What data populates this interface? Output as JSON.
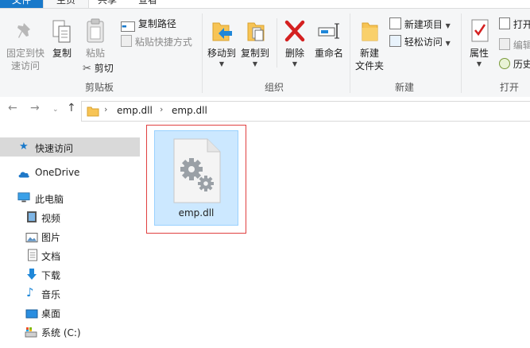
{
  "tabs": {
    "file": "文件",
    "home": "主页",
    "share": "共享",
    "view": "查看"
  },
  "ribbon": {
    "clipboard": {
      "pin_label_1": "固定到快",
      "pin_label_2": "速访问",
      "copy": "复制",
      "paste": "粘贴",
      "copy_path": "复制路径",
      "paste_shortcut": "粘贴快捷方式",
      "cut": "剪切",
      "group": "剪贴板"
    },
    "organize": {
      "move_to": "移动到",
      "copy_to": "复制到",
      "delete": "删除",
      "rename": "重命名",
      "group": "组织"
    },
    "new": {
      "new_folder_1": "新建",
      "new_folder_2": "文件夹",
      "new_item": "新建项目",
      "easy_access": "轻松访问",
      "group": "新建"
    },
    "open": {
      "properties": "属性",
      "open": "打开",
      "edit": "编辑",
      "history": "历史",
      "group": "打开"
    }
  },
  "address": {
    "crumb1": "emp.dll",
    "crumb2": "emp.dll"
  },
  "nav": {
    "quick_access": "快速访问",
    "onedrive": "OneDrive",
    "this_pc": "此电脑",
    "videos": "视频",
    "pictures": "图片",
    "documents": "文档",
    "downloads": "下载",
    "music": "音乐",
    "desktop": "桌面",
    "system_c": "系统 (C:)"
  },
  "files": [
    {
      "name": "emp.dll"
    }
  ],
  "colors": {
    "accent": "#1979ca",
    "selection": "#cce8ff",
    "highlight_box": "#e04040"
  }
}
